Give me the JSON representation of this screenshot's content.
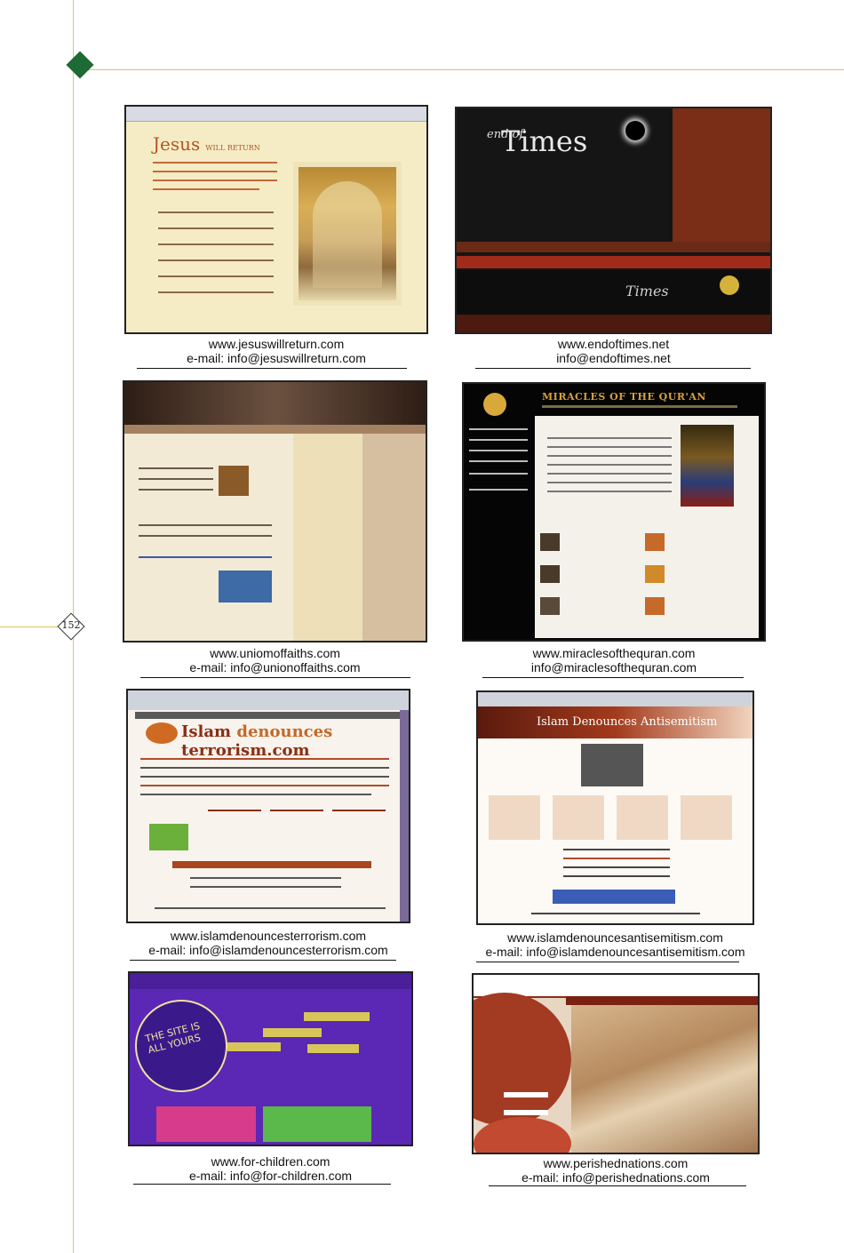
{
  "page_number": "152",
  "items": [
    {
      "url": "www.jesuswillreturn.com",
      "email": "e-mail: info@jesuswillreturn.com",
      "thumb_title": "Jesus",
      "thumb_subtitle": "WILL RETURN"
    },
    {
      "url": "www.endoftimes.net",
      "email": "info@endoftimes.net",
      "thumb_title": "Times",
      "thumb_title_prefix": "end of"
    },
    {
      "url": "www.uniomoffaiths.com",
      "email": "e-mail: info@unionoffaiths.com"
    },
    {
      "url": "www.miraclesofthequran.com",
      "email": "info@miraclesofthequran.com",
      "thumb_title": "MIRACLES OF THE QUR'AN"
    },
    {
      "url": "www.islamdenouncesterrorism.com",
      "email": "e-mail: info@islamdenouncesterrorism.com",
      "thumb_title_a": "Islam ",
      "thumb_title_b": "denounces",
      "thumb_title_c": " terrorism.com"
    },
    {
      "url": "www.islamdenouncesantisemitism.com",
      "email": "e-mail: info@islamdenouncesantisemitism.com",
      "thumb_title": "Islam Denounces Antisemitism"
    },
    {
      "url": "www.for-children.com",
      "email": "e-mail: info@for-children.com",
      "thumb_title": "THE SITE IS ALL YOURS"
    },
    {
      "url": "www.perishednations.com",
      "email": "e-mail: info@perishednations.com"
    }
  ],
  "colors": {
    "frame_line": "#e2c25e",
    "diamond": "#1e6a34"
  }
}
